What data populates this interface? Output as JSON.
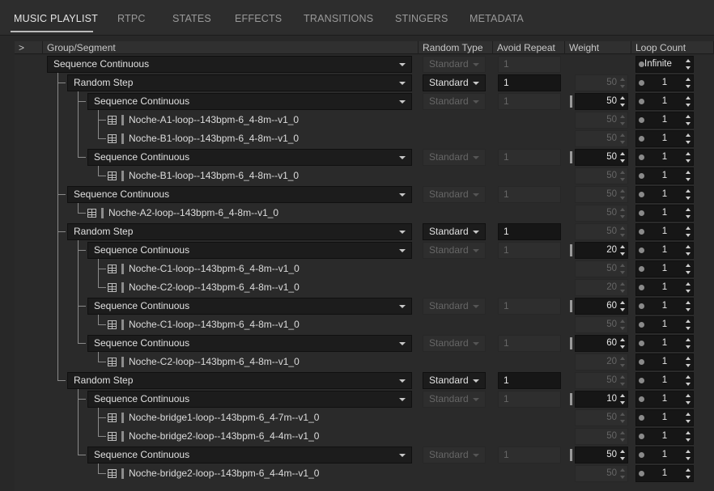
{
  "tabs": [
    {
      "label": "MUSIC PLAYLIST",
      "active": true
    },
    {
      "label": "RTPC"
    },
    {
      "label": "STATES"
    },
    {
      "label": "EFFECTS"
    },
    {
      "label": "TRANSITIONS"
    },
    {
      "label": "STINGERS"
    },
    {
      "label": "METADATA"
    }
  ],
  "columns": {
    "expand": ">",
    "group": "Group/Segment",
    "random_type": "Random Type",
    "avoid_repeat": "Avoid Repeat",
    "weight": "Weight",
    "loop_count": "Loop Count"
  },
  "rows": [
    {
      "kind": "group",
      "depth": 0,
      "label": "Sequence Continuous",
      "rt": "Standard",
      "rt_on": false,
      "ar": "1",
      "ar_on": false,
      "wt": null,
      "wt_on": false,
      "lc": "Infinite"
    },
    {
      "kind": "group",
      "depth": 1,
      "label": "Random Step",
      "rt": "Standard",
      "rt_on": true,
      "ar": "1",
      "ar_on": true,
      "wt": "50",
      "wt_on": false,
      "lc": "1"
    },
    {
      "kind": "group",
      "depth": 2,
      "label": "Sequence Continuous",
      "rt": "Standard",
      "rt_on": false,
      "ar": "1",
      "ar_on": false,
      "wt": "50",
      "wt_on": true,
      "lc": "1"
    },
    {
      "kind": "segment",
      "depth": 3,
      "label": "Noche-A1-loop--143bpm-6_4-8m--v1_0",
      "wt": "50",
      "wt_on": false,
      "lc": "1"
    },
    {
      "kind": "segment",
      "depth": 3,
      "label": "Noche-B1-loop--143bpm-6_4-8m--v1_0",
      "wt": "50",
      "wt_on": false,
      "lc": "1"
    },
    {
      "kind": "group",
      "depth": 2,
      "label": "Sequence Continuous",
      "rt": "Standard",
      "rt_on": false,
      "ar": "1",
      "ar_on": false,
      "wt": "50",
      "wt_on": true,
      "lc": "1"
    },
    {
      "kind": "segment",
      "depth": 3,
      "label": "Noche-B1-loop--143bpm-6_4-8m--v1_0",
      "wt": "50",
      "wt_on": false,
      "lc": "1"
    },
    {
      "kind": "group",
      "depth": 1,
      "label": "Sequence Continuous",
      "rt": "Standard",
      "rt_on": false,
      "ar": "1",
      "ar_on": false,
      "wt": "50",
      "wt_on": false,
      "lc": "1"
    },
    {
      "kind": "segment",
      "depth": 2,
      "label": "Noche-A2-loop--143bpm-6_4-8m--v1_0",
      "wt": "50",
      "wt_on": false,
      "lc": "1"
    },
    {
      "kind": "group",
      "depth": 1,
      "label": "Random Step",
      "rt": "Standard",
      "rt_on": true,
      "ar": "1",
      "ar_on": true,
      "wt": "50",
      "wt_on": false,
      "lc": "1"
    },
    {
      "kind": "group",
      "depth": 2,
      "label": "Sequence Continuous",
      "rt": "Standard",
      "rt_on": false,
      "ar": "1",
      "ar_on": false,
      "wt": "20",
      "wt_on": true,
      "lc": "1"
    },
    {
      "kind": "segment",
      "depth": 3,
      "label": "Noche-C1-loop--143bpm-6_4-8m--v1_0",
      "wt": "50",
      "wt_on": false,
      "lc": "1"
    },
    {
      "kind": "segment",
      "depth": 3,
      "label": "Noche-C2-loop--143bpm-6_4-8m--v1_0",
      "wt": "20",
      "wt_on": false,
      "lc": "1"
    },
    {
      "kind": "group",
      "depth": 2,
      "label": "Sequence Continuous",
      "rt": "Standard",
      "rt_on": false,
      "ar": "1",
      "ar_on": false,
      "wt": "60",
      "wt_on": true,
      "lc": "1"
    },
    {
      "kind": "segment",
      "depth": 3,
      "label": "Noche-C1-loop--143bpm-6_4-8m--v1_0",
      "wt": "50",
      "wt_on": false,
      "lc": "1"
    },
    {
      "kind": "group",
      "depth": 2,
      "label": "Sequence Continuous",
      "rt": "Standard",
      "rt_on": false,
      "ar": "1",
      "ar_on": false,
      "wt": "60",
      "wt_on": true,
      "lc": "1"
    },
    {
      "kind": "segment",
      "depth": 3,
      "label": "Noche-C2-loop--143bpm-6_4-8m--v1_0",
      "wt": "20",
      "wt_on": false,
      "lc": "1"
    },
    {
      "kind": "group",
      "depth": 1,
      "label": "Random Step",
      "rt": "Standard",
      "rt_on": true,
      "ar": "1",
      "ar_on": true,
      "wt": "50",
      "wt_on": false,
      "lc": "1"
    },
    {
      "kind": "group",
      "depth": 2,
      "label": "Sequence Continuous",
      "rt": "Standard",
      "rt_on": false,
      "ar": "1",
      "ar_on": false,
      "wt": "10",
      "wt_on": true,
      "lc": "1"
    },
    {
      "kind": "segment",
      "depth": 3,
      "label": "Noche-bridge1-loop--143bpm-6_4-7m--v1_0",
      "wt": "50",
      "wt_on": false,
      "lc": "1"
    },
    {
      "kind": "segment",
      "depth": 3,
      "label": "Noche-bridge2-loop--143bpm-6_4-4m--v1_0",
      "wt": "50",
      "wt_on": false,
      "lc": "1"
    },
    {
      "kind": "group",
      "depth": 2,
      "label": "Sequence Continuous",
      "rt": "Standard",
      "rt_on": false,
      "ar": "1",
      "ar_on": false,
      "wt": "50",
      "wt_on": true,
      "lc": "1"
    },
    {
      "kind": "segment",
      "depth": 3,
      "label": "Noche-bridge2-loop--143bpm-6_4-4m--v1_0",
      "wt": "50",
      "wt_on": false,
      "lc": "1"
    }
  ]
}
